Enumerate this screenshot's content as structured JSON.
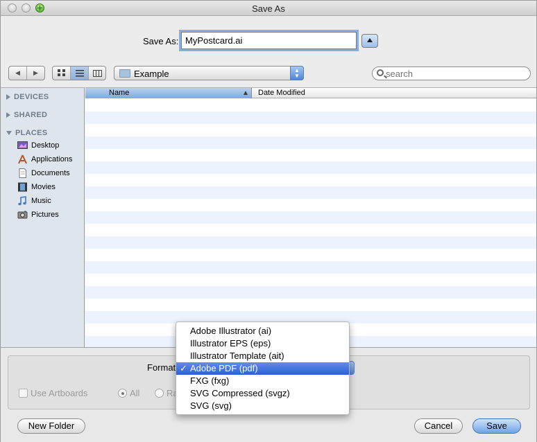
{
  "window": {
    "title": "Save As"
  },
  "save_as": {
    "label": "Save As:",
    "filename": "MyPostcard.ai"
  },
  "toolbar": {
    "back_glyph": "◀",
    "forward_glyph": "▶",
    "location": "Example",
    "search_placeholder": "search",
    "view_mode": "list"
  },
  "sidebar": {
    "sections": [
      {
        "label": "DEVICES",
        "expanded": false
      },
      {
        "label": "SHARED",
        "expanded": false
      },
      {
        "label": "PLACES",
        "expanded": true
      }
    ],
    "places": [
      {
        "label": "Desktop",
        "icon": "desktop-icon"
      },
      {
        "label": "Applications",
        "icon": "applications-icon"
      },
      {
        "label": "Documents",
        "icon": "documents-icon"
      },
      {
        "label": "Movies",
        "icon": "movies-icon"
      },
      {
        "label": "Music",
        "icon": "music-icon"
      },
      {
        "label": "Pictures",
        "icon": "pictures-icon"
      }
    ]
  },
  "file_list": {
    "columns": [
      "Name",
      "Date Modified"
    ],
    "sort_column": "Name",
    "rows": []
  },
  "options": {
    "format_label": "Format",
    "use_artboards": "Use Artboards",
    "radio_all": "All",
    "radio_range": "Ra"
  },
  "format_menu": {
    "items": [
      "Adobe Illustrator (ai)",
      "Illustrator EPS (eps)",
      "Illustrator Template (ait)",
      "Adobe PDF (pdf)",
      "FXG (fxg)",
      "SVG Compressed (svgz)",
      "SVG (svg)"
    ],
    "selected": "Adobe PDF (pdf)",
    "check_glyph": "✓"
  },
  "buttons": {
    "new_folder": "New Folder",
    "cancel": "Cancel",
    "save": "Save"
  },
  "colors": {
    "selection": "#2d5fd8",
    "sidebar_bg": "#dfe5ed",
    "row_stripe": "#edf3fe"
  }
}
